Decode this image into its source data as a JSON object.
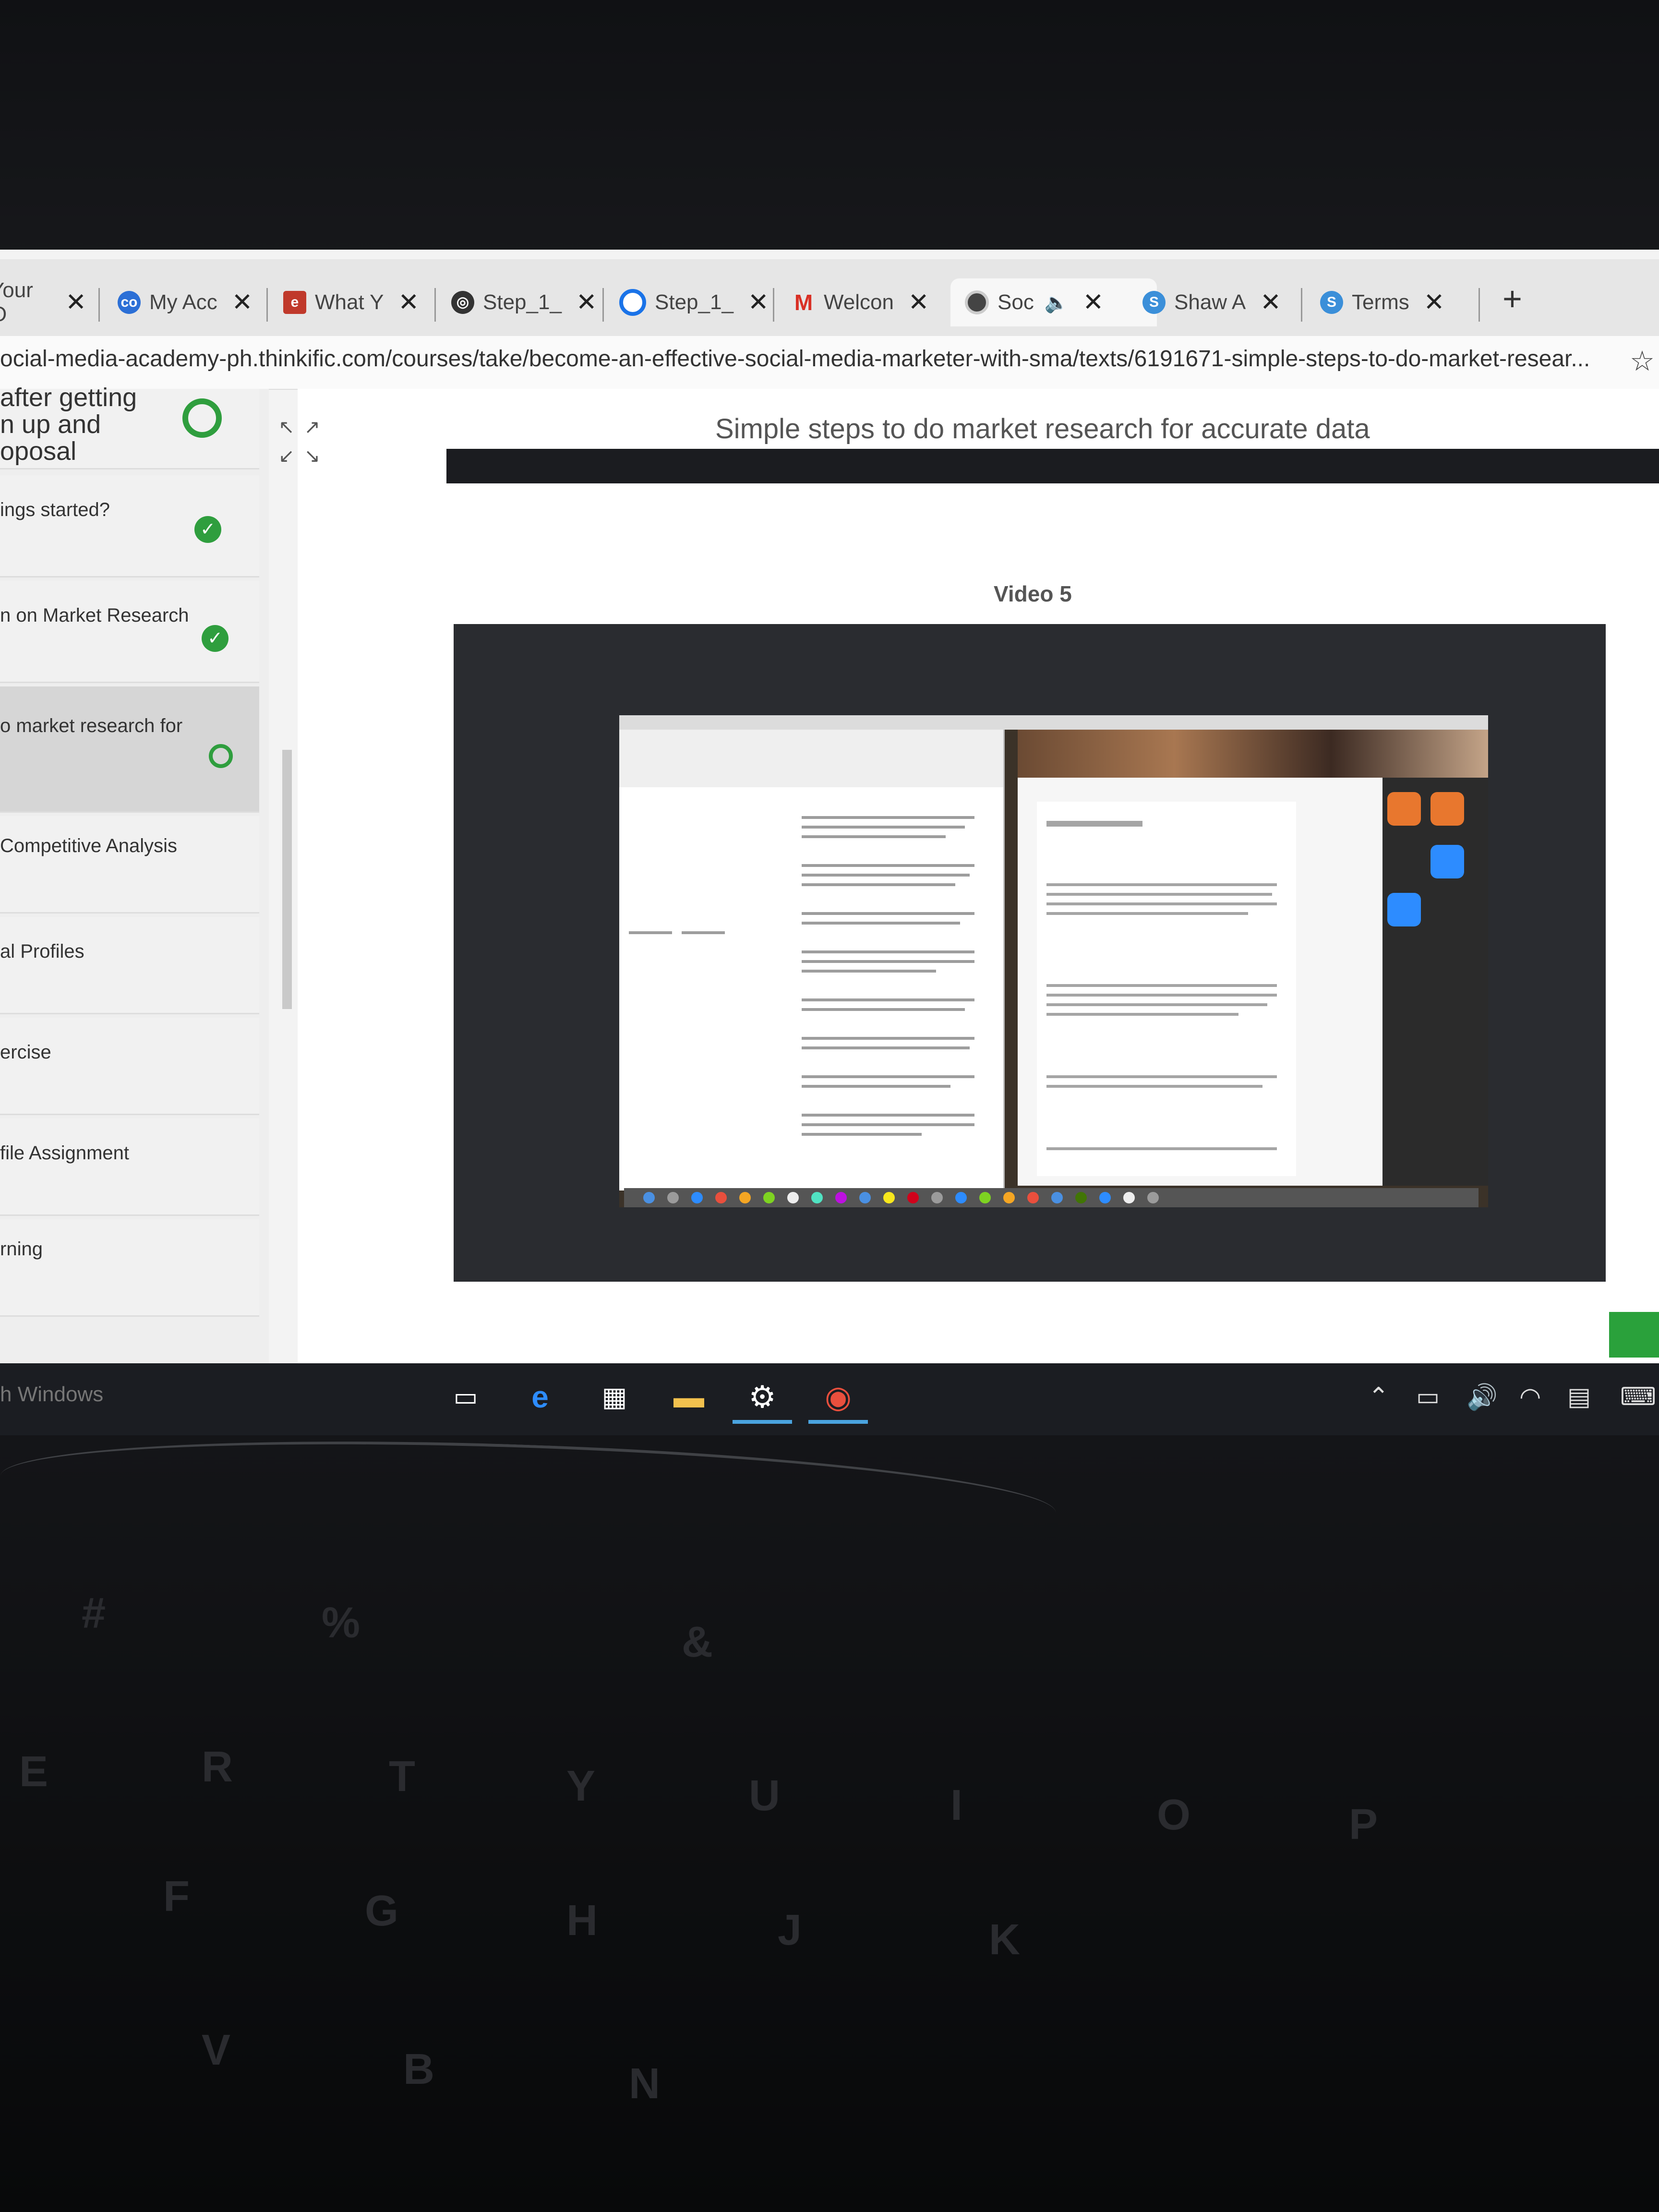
{
  "tabs": [
    {
      "label": "Your O",
      "icon": "world-icon"
    },
    {
      "label": "My Acc",
      "icon": "co-icon"
    },
    {
      "label": "What Y",
      "icon": "edx-icon"
    },
    {
      "label": "Step_1_",
      "icon": "globe-icon"
    },
    {
      "label": "Step_1_",
      "icon": "circle-icon"
    },
    {
      "label": "Welcon",
      "icon": "gmail-icon"
    },
    {
      "label": "Soc",
      "icon": "record-icon",
      "active": true
    },
    {
      "label": "Shaw A",
      "icon": "s-icon"
    },
    {
      "label": "Terms",
      "icon": "s-icon"
    }
  ],
  "address_bar": {
    "url": "ocial-media-academy-ph.thinkific.com/courses/take/become-an-effective-social-media-marketer-with-sma/texts/6191671-simple-steps-to-do-market-resear..."
  },
  "sidebar": {
    "items": [
      {
        "label_lines": [
          "after getting",
          "n up and",
          "oposal"
        ],
        "status": "in-progress"
      },
      {
        "label_lines": [
          "ings started?"
        ],
        "status": "complete"
      },
      {
        "label_lines": [
          "n on Market Research"
        ],
        "status": "complete"
      },
      {
        "label_lines": [
          "o market research for"
        ],
        "status": "in-progress"
      },
      {
        "label_lines": [
          "Competitive Analysis"
        ],
        "status": "none"
      },
      {
        "label_lines": [
          "al Profiles"
        ],
        "status": "none"
      },
      {
        "label_lines": [
          "ercise"
        ],
        "status": "none"
      },
      {
        "label_lines": [
          "file Assignment"
        ],
        "status": "none"
      },
      {
        "label_lines": [
          "rning"
        ],
        "status": "none"
      }
    ]
  },
  "content": {
    "title": "Simple steps to do market research for accurate data",
    "video_label": "Video 5"
  },
  "taskbar": {
    "search_text": "h Windows"
  },
  "colors": {
    "accent": "#2f9e3e",
    "video_bg": "#2a2c30",
    "taskbar": "#1b1d22"
  }
}
